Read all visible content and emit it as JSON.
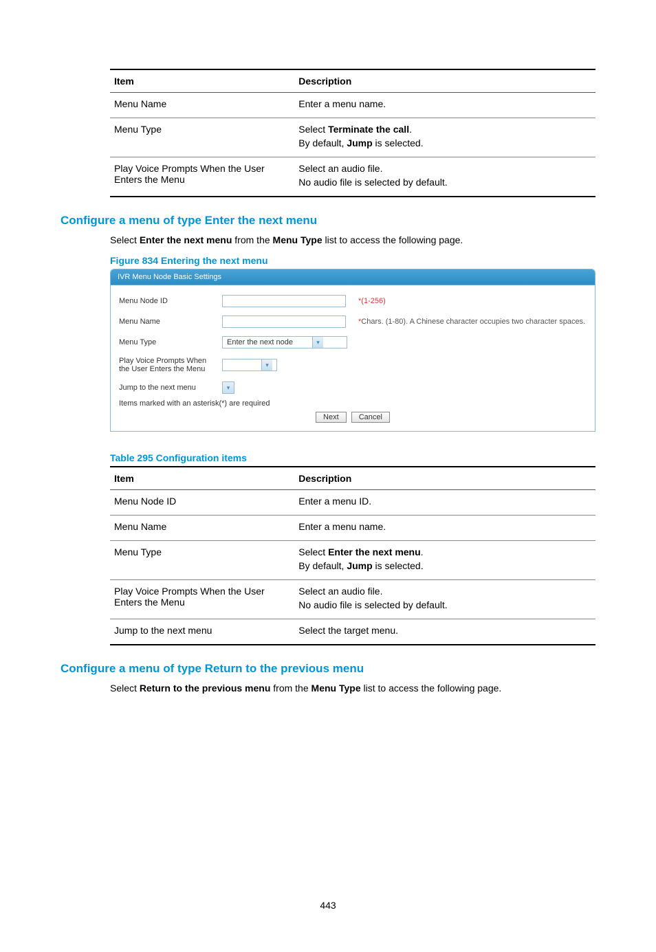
{
  "page_number": "443",
  "table_a": {
    "headers": {
      "item": "Item",
      "desc": "Description"
    },
    "rows": [
      {
        "item": "Menu Name",
        "desc_lines": [
          {
            "pre": "Enter a menu name.",
            "bold": "",
            "post": ""
          }
        ]
      },
      {
        "item": "Menu Type",
        "desc_lines": [
          {
            "pre": "Select ",
            "bold": "Terminate the call",
            "post": "."
          },
          {
            "pre": "By default, ",
            "bold": "Jump",
            "post": " is selected."
          }
        ]
      },
      {
        "item": "Play Voice Prompts When the User Enters the Menu",
        "desc_lines": [
          {
            "pre": "Select an audio file.",
            "bold": "",
            "post": ""
          },
          {
            "pre": "No audio file is selected by default.",
            "bold": "",
            "post": ""
          }
        ]
      }
    ]
  },
  "section1": {
    "heading": "Configure a menu of type Enter the next menu",
    "text_pre": "Select ",
    "text_b1": "Enter the next menu",
    "text_mid": " from the ",
    "text_b2": "Menu Type",
    "text_post": " list to access the following page."
  },
  "figure": {
    "caption": "Figure 834 Entering the next menu",
    "header": "IVR Menu Node Basic Settings",
    "rows": {
      "id_label": "Menu Node ID",
      "id_hint": "*(1-256)",
      "name_label": "Menu Name",
      "name_hint": "*Chars. (1-80). A Chinese character occupies two character spaces.",
      "type_label": "Menu Type",
      "type_value": "Enter the next node",
      "prompt_label": "Play Voice Prompts When the User Enters the Menu",
      "jump_label": "Jump to the next menu"
    },
    "note": "Items marked with an asterisk(*) are required",
    "btn_next": "Next",
    "btn_cancel": "Cancel"
  },
  "table_b": {
    "caption": "Table 295 Configuration items",
    "headers": {
      "item": "Item",
      "desc": "Description"
    },
    "rows": [
      {
        "item": "Menu Node ID",
        "desc_lines": [
          {
            "pre": "Enter a menu ID.",
            "bold": "",
            "post": ""
          }
        ]
      },
      {
        "item": "Menu Name",
        "desc_lines": [
          {
            "pre": "Enter a menu name.",
            "bold": "",
            "post": ""
          }
        ]
      },
      {
        "item": "Menu Type",
        "desc_lines": [
          {
            "pre": "Select ",
            "bold": "Enter the next menu",
            "post": "."
          },
          {
            "pre": "By default, ",
            "bold": "Jump",
            "post": " is selected."
          }
        ]
      },
      {
        "item": "Play Voice Prompts When the User Enters the Menu",
        "desc_lines": [
          {
            "pre": "Select an audio file.",
            "bold": "",
            "post": ""
          },
          {
            "pre": "No audio file is selected by default.",
            "bold": "",
            "post": ""
          }
        ]
      },
      {
        "item": "Jump to the next menu",
        "desc_lines": [
          {
            "pre": "Select the target menu.",
            "bold": "",
            "post": ""
          }
        ]
      }
    ]
  },
  "section2": {
    "heading": "Configure a menu of type Return to the previous menu",
    "text_pre": "Select ",
    "text_b1": "Return to the previous menu",
    "text_mid": " from the ",
    "text_b2": "Menu Type",
    "text_post": " list to access the following page."
  }
}
